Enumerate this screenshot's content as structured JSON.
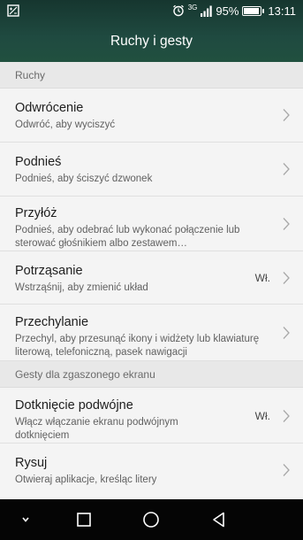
{
  "status": {
    "network": "3G",
    "battery": "95%",
    "battery_level": 0.95,
    "time": "13:11"
  },
  "header": {
    "title": "Ruchy i gesty"
  },
  "sections": [
    {
      "title": "Ruchy"
    },
    {
      "title": "Gesty dla zgaszonego ekranu"
    }
  ],
  "items": [
    {
      "title": "Odwrócenie",
      "subtitle": "Odwróć, aby wyciszyć",
      "value": ""
    },
    {
      "title": "Podnieś",
      "subtitle": "Podnieś, aby ściszyć dzwonek",
      "value": ""
    },
    {
      "title": "Przyłóż",
      "subtitle": "Podnieś, aby odebrać lub wykonać połączenie lub sterować głośnikiem albo zestawem…",
      "value": ""
    },
    {
      "title": "Potrząsanie",
      "subtitle": "Wstrząśnij, aby zmienić układ",
      "value": "Wł."
    },
    {
      "title": "Przechylanie",
      "subtitle": "Przechyl, aby przesunąć ikony i widżety lub klawiaturę literową, telefoniczną, pasek nawigacji",
      "value": ""
    },
    {
      "title": "Dotknięcie podwójne",
      "subtitle": "Włącz włączanie ekranu podwójnym dotknięciem",
      "value": "Wł."
    },
    {
      "title": "Rysuj",
      "subtitle": "Otwieraj aplikacje, kreśląc litery",
      "value": ""
    }
  ],
  "nav": {
    "icons": [
      "chevron-down-icon",
      "square-icon",
      "circle-icon",
      "triangle-back-icon"
    ]
  },
  "colors": {
    "header": "#1f4a40",
    "background": "#f4f4f4",
    "section": "#e8e8e8"
  }
}
